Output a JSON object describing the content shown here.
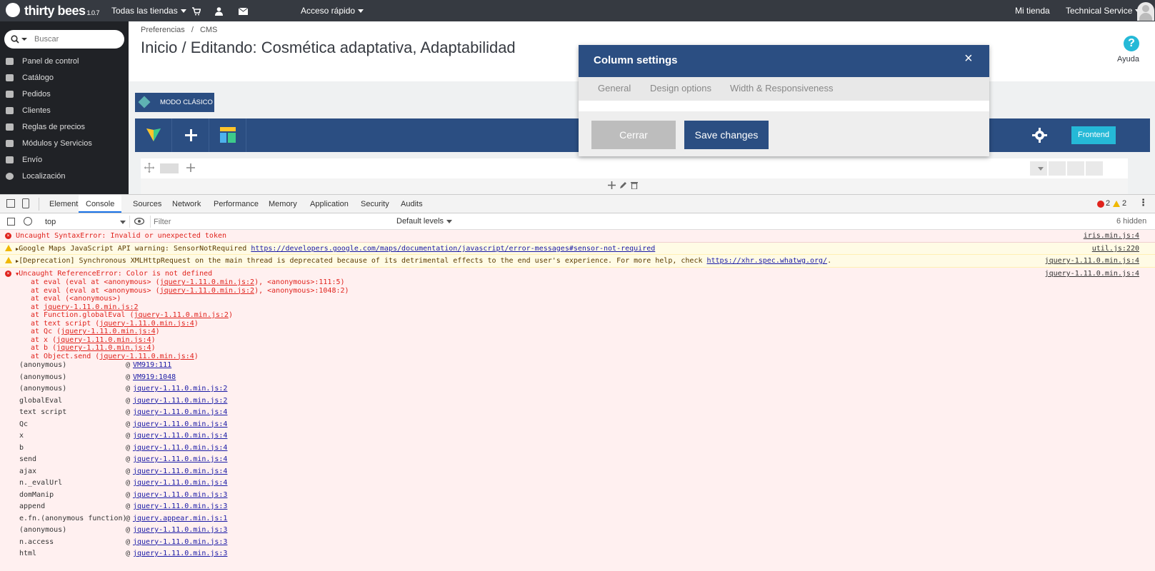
{
  "topbar": {
    "logo": "thirty bees",
    "version": "1.0.7",
    "stores": "Todas las tiendas",
    "quick_access": "Acceso rápido",
    "my_store": "Mi tienda",
    "user": "Technical Service"
  },
  "sidebar": {
    "search_placeholder": "Buscar",
    "items": [
      {
        "label": "Panel de control",
        "icon": "dashboard-icon"
      },
      {
        "label": "Catálogo",
        "icon": "book-icon"
      },
      {
        "label": "Pedidos",
        "icon": "credit-card-icon"
      },
      {
        "label": "Clientes",
        "icon": "users-icon"
      },
      {
        "label": "Reglas de precios",
        "icon": "tags-icon"
      },
      {
        "label": "Módulos y Servicios",
        "icon": "puzzle-icon"
      },
      {
        "label": "Envío",
        "icon": "truck-icon"
      },
      {
        "label": "Localización",
        "icon": "globe-icon"
      }
    ]
  },
  "main": {
    "breadcrumb": [
      "Preferencias",
      "CMS"
    ],
    "breadcrumb_sep": "/",
    "title": "Inicio / Editando: Cosmética adaptativa, Adaptabilidad",
    "help": "Ayuda",
    "classic_mode": "MODO CLÁSICO",
    "frontend": "Frontend"
  },
  "modal": {
    "title": "Column settings",
    "close": "×",
    "tabs": [
      "General",
      "Design options",
      "Width & Responsiveness"
    ],
    "cancel": "Cerrar",
    "save": "Save changes"
  },
  "devtools": {
    "tabs": [
      "Elements",
      "Console",
      "Sources",
      "Network",
      "Performance",
      "Memory",
      "Application",
      "Security",
      "Audits"
    ],
    "active_tab": "Console",
    "error_count": "2",
    "warning_count": "2",
    "context": "top",
    "filter_placeholder": "Filter",
    "levels": "Default levels",
    "hidden": "6 hidden",
    "messages": [
      {
        "type": "error",
        "text": "Uncaught SyntaxError: Invalid or unexpected token",
        "source": "iris.min.js:4"
      },
      {
        "type": "warning",
        "text": "Google Maps JavaScript API warning: SensorNotRequired ",
        "link": "https://developers.google.com/maps/documentation/javascript/error-messages#sensor-not-required",
        "source": "util.js:220"
      },
      {
        "type": "warning",
        "text": "[Deprecation] Synchronous XMLHttpRequest on the main thread is deprecated because of its detrimental effects to the end user's experience. For more help, check ",
        "link": "https://xhr.spec.whatwg.org/",
        "tail": ".",
        "source": "jquery-1.11.0.min.js:4"
      },
      {
        "type": "error",
        "text": "Uncaught ReferenceError: Color is not defined",
        "source": "jquery-1.11.0.min.js:4"
      }
    ],
    "stack": [
      {
        "pre": "at eval (eval at <anonymous> (",
        "link": "jquery-1.11.0.min.js:2",
        "post": "), <anonymous>:111:5)"
      },
      {
        "pre": "at eval (eval at <anonymous> (",
        "link": "jquery-1.11.0.min.js:2",
        "post": "), <anonymous>:1048:2)"
      },
      {
        "pre": "at eval (<anonymous>)",
        "link": "",
        "post": ""
      },
      {
        "pre": "at ",
        "link": "jquery-1.11.0.min.js:2",
        "post": ""
      },
      {
        "pre": "at Function.globalEval (",
        "link": "jquery-1.11.0.min.js:2",
        "post": ")"
      },
      {
        "pre": "at text script (",
        "link": "jquery-1.11.0.min.js:4",
        "post": ")"
      },
      {
        "pre": "at Qc (",
        "link": "jquery-1.11.0.min.js:4",
        "post": ")"
      },
      {
        "pre": "at x (",
        "link": "jquery-1.11.0.min.js:4",
        "post": ")"
      },
      {
        "pre": "at b (",
        "link": "jquery-1.11.0.min.js:4",
        "post": ")"
      },
      {
        "pre": "at Object.send (",
        "link": "jquery-1.11.0.min.js:4",
        "post": ")"
      }
    ],
    "call_table": [
      {
        "fn": "(anonymous)",
        "src": "VM919:111"
      },
      {
        "fn": "(anonymous)",
        "src": "VM919:1048"
      },
      {
        "fn": "(anonymous)",
        "src": "jquery-1.11.0.min.js:2"
      },
      {
        "fn": "globalEval",
        "src": "jquery-1.11.0.min.js:2"
      },
      {
        "fn": "text script",
        "src": "jquery-1.11.0.min.js:4"
      },
      {
        "fn": "Qc",
        "src": "jquery-1.11.0.min.js:4"
      },
      {
        "fn": "x",
        "src": "jquery-1.11.0.min.js:4"
      },
      {
        "fn": "b",
        "src": "jquery-1.11.0.min.js:4"
      },
      {
        "fn": "send",
        "src": "jquery-1.11.0.min.js:4"
      },
      {
        "fn": "ajax",
        "src": "jquery-1.11.0.min.js:4"
      },
      {
        "fn": "n._evalUrl",
        "src": "jquery-1.11.0.min.js:4"
      },
      {
        "fn": "domManip",
        "src": "jquery-1.11.0.min.js:3"
      },
      {
        "fn": "append",
        "src": "jquery-1.11.0.min.js:3"
      },
      {
        "fn": "e.fn.(anonymous function)",
        "src": "jquery.appear.min.js:1"
      },
      {
        "fn": "(anonymous)",
        "src": "jquery-1.11.0.min.js:3"
      },
      {
        "fn": "n.access",
        "src": "jquery-1.11.0.min.js:3"
      },
      {
        "fn": "html",
        "src": "jquery-1.11.0.min.js:3"
      }
    ],
    "at_symbol": "@"
  },
  "colors": {
    "topbar": "#363a41",
    "sidebar": "#202226",
    "accent_blue": "#2b4e82",
    "frontend_button": "#25b9d7",
    "error_text": "#e0231d"
  }
}
